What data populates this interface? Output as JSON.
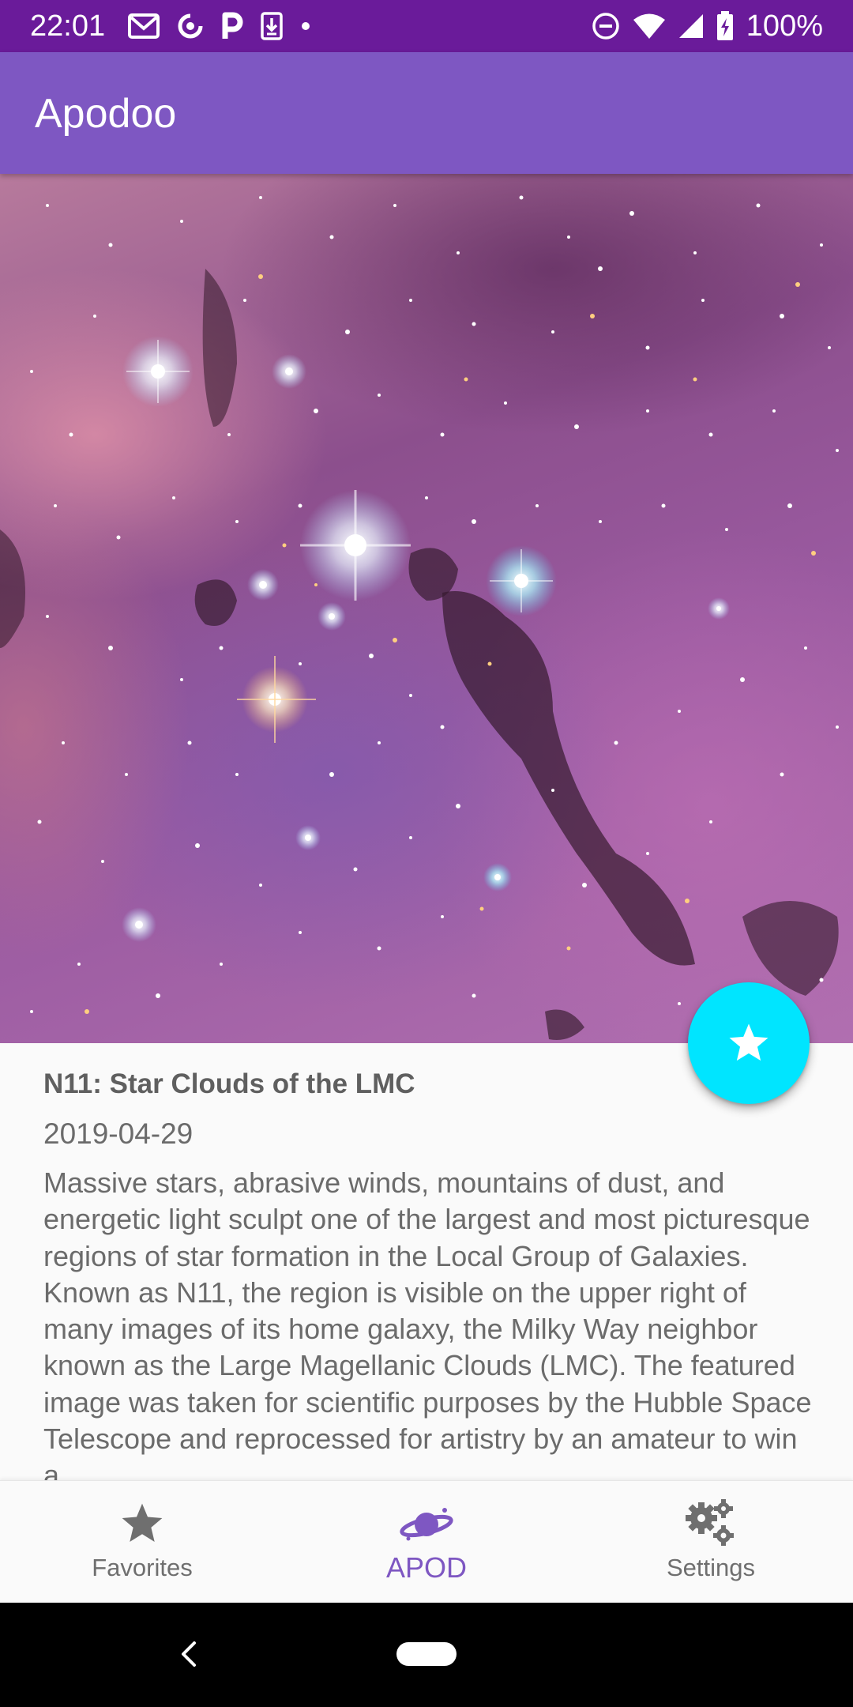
{
  "status_bar": {
    "time": "22:01",
    "battery": "100%",
    "left_icons": [
      "gmail-icon",
      "sync-icon",
      "parking-icon",
      "download-icon",
      "dot-icon"
    ],
    "right_icons": [
      "dnd-icon",
      "wifi-icon",
      "signal-icon",
      "battery-icon"
    ]
  },
  "app_bar": {
    "title": "Apodoo"
  },
  "apod": {
    "title": "N11: Star Clouds of the LMC",
    "date": "2019-04-29",
    "explanation": "Massive stars, abrasive winds, mountains of dust, and energetic light sculpt one of the largest and most picturesque regions of star formation in the Local Group of Galaxies.  Known as N11, the region is visible on the upper right of many images of its home galaxy, the Milky Way neighbor known as the Large Magellanic Clouds (LMC).  The featured image was taken for scientific purposes by the Hubble Space Telescope and reprocessed for artistry by an amateur to win a"
  },
  "fab": {
    "icon": "star-icon",
    "color": "#00e5ff"
  },
  "bottom_nav": {
    "items": [
      {
        "label": "Favorites",
        "icon": "star-icon",
        "active": false
      },
      {
        "label": "APOD",
        "icon": "planet-icon",
        "active": true
      },
      {
        "label": "Settings",
        "icon": "gears-icon",
        "active": false
      }
    ]
  },
  "colors": {
    "status_bar": "#6a1b9a",
    "app_bar": "#7e57c2",
    "accent": "#00e5ff",
    "active_nav": "#7e57c2",
    "inactive_nav": "#6f6f6f"
  }
}
